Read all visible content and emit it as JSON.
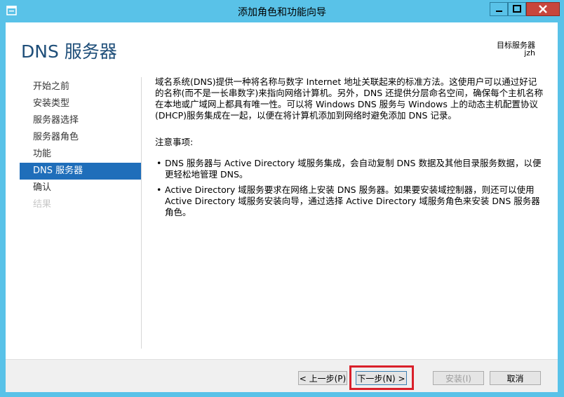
{
  "window": {
    "title": "添加角色和功能向导",
    "controls": [
      "minimize-icon",
      "maximize-icon",
      "close-icon"
    ],
    "accent_color": "#59c2e8"
  },
  "header": {
    "page_title": "DNS 服务器",
    "target_label": "目标服务器",
    "target_name": "jzh"
  },
  "nav": {
    "items": [
      {
        "label": "开始之前",
        "state": "normal"
      },
      {
        "label": "安装类型",
        "state": "normal"
      },
      {
        "label": "服务器选择",
        "state": "normal"
      },
      {
        "label": "服务器角色",
        "state": "normal"
      },
      {
        "label": "功能",
        "state": "normal"
      },
      {
        "label": "DNS 服务器",
        "state": "active"
      },
      {
        "label": "确认",
        "state": "normal"
      },
      {
        "label": "结果",
        "state": "disabled"
      }
    ],
    "active_color": "#1f6eba"
  },
  "content": {
    "intro": "域名系统(DNS)提供一种将名称与数字 Internet 地址关联起来的标准方法。这使用户可以通过好记的名称(而不是一长串数字)来指向网络计算机。另外，DNS 还提供分层命名空间，确保每个主机名称在本地或广域网上都具有唯一性。可以将 Windows DNS 服务与 Windows 上的动态主机配置协议(DHCP)服务集成在一起，以便在将计算机添加到网络时避免添加 DNS 记录。",
    "notice_title": "注意事项:",
    "bullets": [
      "DNS 服务器与 Active Directory 域服务集成，会自动复制 DNS 数据及其他目录服务数据，以便更轻松地管理 DNS。",
      "Active Directory 域服务要求在网络上安装 DNS 服务器。如果要安装域控制器，则还可以使用 Active Directory 域服务安装向导，通过选择 Active Directory 域服务角色来安装 DNS 服务器角色。"
    ]
  },
  "footer": {
    "prev_label": "< 上一步(P)",
    "next_label": "下一步(N) >",
    "install_label": "安装(I)",
    "cancel_label": "取消",
    "highlight_color": "#d9202a"
  }
}
